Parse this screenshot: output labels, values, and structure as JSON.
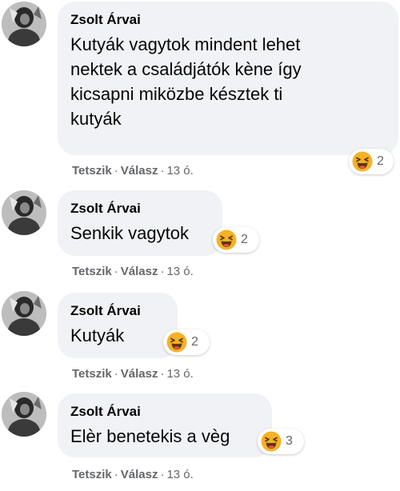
{
  "comments": [
    {
      "author": "Zsolt Árvai",
      "text_lines": [
        "Kutyák vagytok mindent lehet",
        "nektek a családjátók kène így",
        "kicsapni miközbe késztek ti",
        "kutyák"
      ],
      "reaction": {
        "icon": "haha-emoji-icon",
        "count": "2"
      },
      "actions": {
        "like": "Tetszik",
        "reply": "Válasz",
        "separator": "·",
        "time": "13 ó."
      }
    },
    {
      "author": "Zsolt Árvai",
      "text_lines": [
        "Senkik vagytok"
      ],
      "reaction": {
        "icon": "haha-emoji-icon",
        "count": "2"
      },
      "actions": {
        "like": "Tetszik",
        "reply": "Válasz",
        "separator": "·",
        "time": "13 ó."
      }
    },
    {
      "author": "Zsolt Árvai",
      "text_lines": [
        "Kutyák"
      ],
      "reaction": {
        "icon": "haha-emoji-icon",
        "count": "2"
      },
      "actions": {
        "like": "Tetszik",
        "reply": "Válasz",
        "separator": "·",
        "time": "13 ó."
      }
    },
    {
      "author": "Zsolt Árvai",
      "text_lines": [
        "Elèr benetekis a vèg"
      ],
      "reaction": {
        "icon": "haha-emoji-icon",
        "count": "3"
      },
      "actions": {
        "like": "Tetszik",
        "reply": "Válasz",
        "separator": "·",
        "time": "13 ó."
      }
    }
  ],
  "colors": {
    "bubble": "#f0f2f5",
    "text": "#050505",
    "secondary_text": "#65676b",
    "haha_emoji": "#f7b125"
  }
}
